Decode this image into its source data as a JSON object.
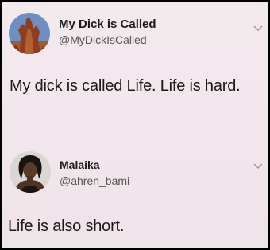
{
  "tweets": [
    {
      "display_name": "My Dick is Called",
      "handle": "@MyDickIsCalled",
      "text": "My dick is called Life. Life is hard.",
      "avatar_icon": "rock-formation-avatar"
    },
    {
      "display_name": "Malaika",
      "handle": "@ahren_bami",
      "text": "Life is also short.",
      "avatar_icon": "profile-photo-avatar"
    }
  ],
  "colors": {
    "background": "#f2e8ed",
    "text": "#1b1b1b",
    "handle": "#555555",
    "border": "#000000"
  }
}
